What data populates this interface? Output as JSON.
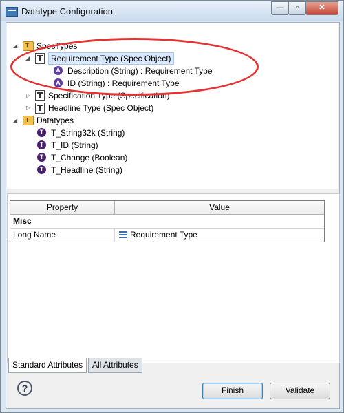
{
  "window": {
    "title": "Datatype Configuration",
    "min_symbol": "—",
    "max_symbol": "▫",
    "close_symbol": "✕"
  },
  "tree": {
    "spec_types": {
      "label": "SpecTypes",
      "folder_letter": "T",
      "children": [
        {
          "label": "Requirement Type (Spec Object)",
          "expanded": true,
          "selected": true,
          "children": [
            {
              "label": "Description (String) : Requirement Type",
              "icon_letter": "A"
            },
            {
              "label": "ID (String) : Requirement Type",
              "icon_letter": "A"
            }
          ]
        },
        {
          "label": "Specification Type (Specification)",
          "expanded": false
        },
        {
          "label": "Headline Type (Spec Object)",
          "expanded": false
        }
      ]
    },
    "datatypes": {
      "label": "Datatypes",
      "folder_letter": "T",
      "children": [
        {
          "label": "T_String32k (String)",
          "icon_letter": "T"
        },
        {
          "label": "T_ID (String)",
          "icon_letter": "T"
        },
        {
          "label": "T_Change (Boolean)",
          "icon_letter": "T"
        },
        {
          "label": "T_Headline (String)",
          "icon_letter": "T"
        }
      ]
    }
  },
  "properties": {
    "col_property": "Property",
    "col_value": "Value",
    "category": "Misc",
    "rows": [
      {
        "name": "Long Name",
        "value": "Requirement Type"
      }
    ]
  },
  "tabs": [
    "Standard Attributes",
    "All Attributes"
  ],
  "buttons": {
    "help": "?",
    "finish": "Finish",
    "validate": "Validate"
  },
  "colors": {
    "highlight": "#e23434",
    "selection": "#d9e8fb"
  }
}
